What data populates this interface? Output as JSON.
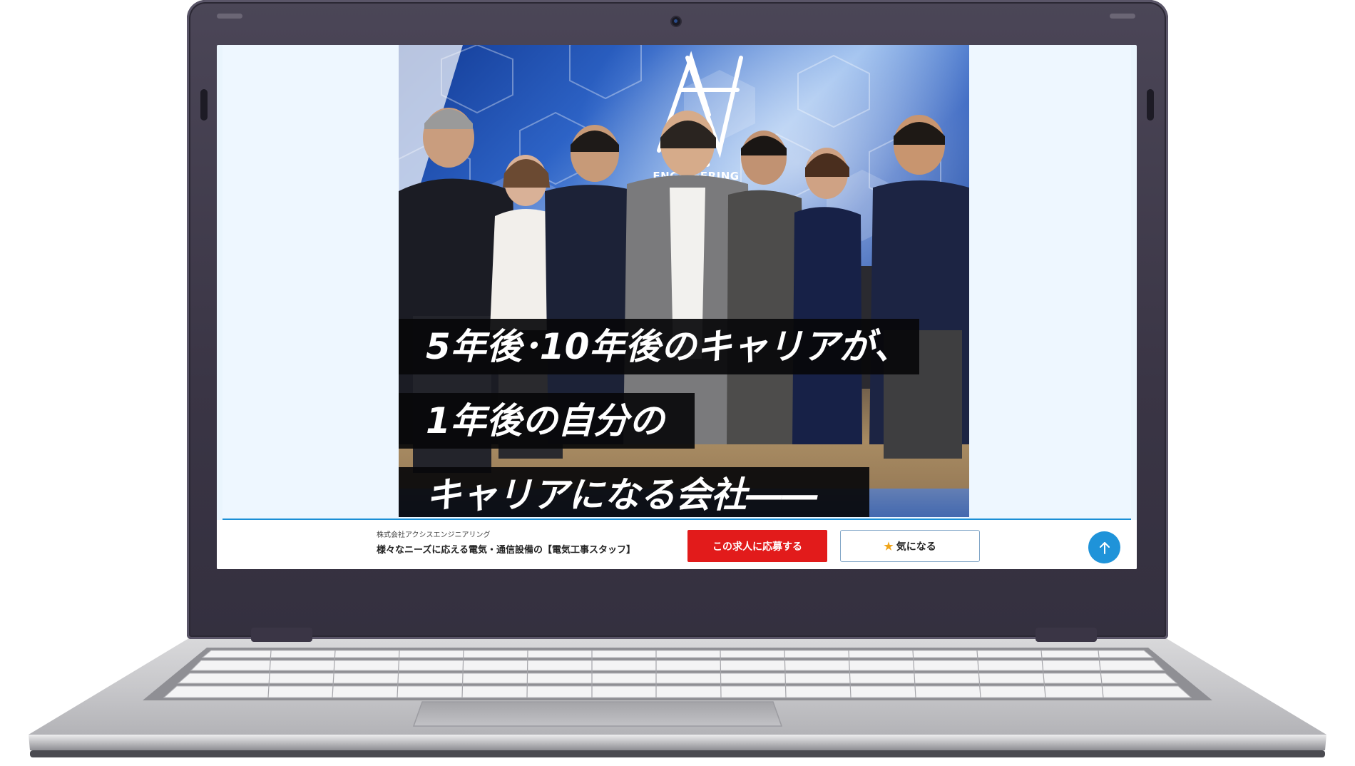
{
  "hero": {
    "logo_text": "AXIS ENGINEERING",
    "captions": [
      "5年後･10年後のキャリアが、",
      "1年後の自分の",
      "キャリアになる会社――"
    ]
  },
  "footer_bar": {
    "company_name": "株式会社アクシスエンジニアリング",
    "job_title": "様々なニーズに応える電気・通信設備の【電気工事スタッフ】",
    "apply_label": "この求人に応募する",
    "favorite_label": "気になる",
    "favorite_icon": "star-icon",
    "scroll_top_icon": "arrow-up-icon"
  },
  "colors": {
    "apply": "#e21b1b",
    "scroll_top": "#1f93d9",
    "divider": "#1b8fd6",
    "star": "#f0a51a"
  }
}
